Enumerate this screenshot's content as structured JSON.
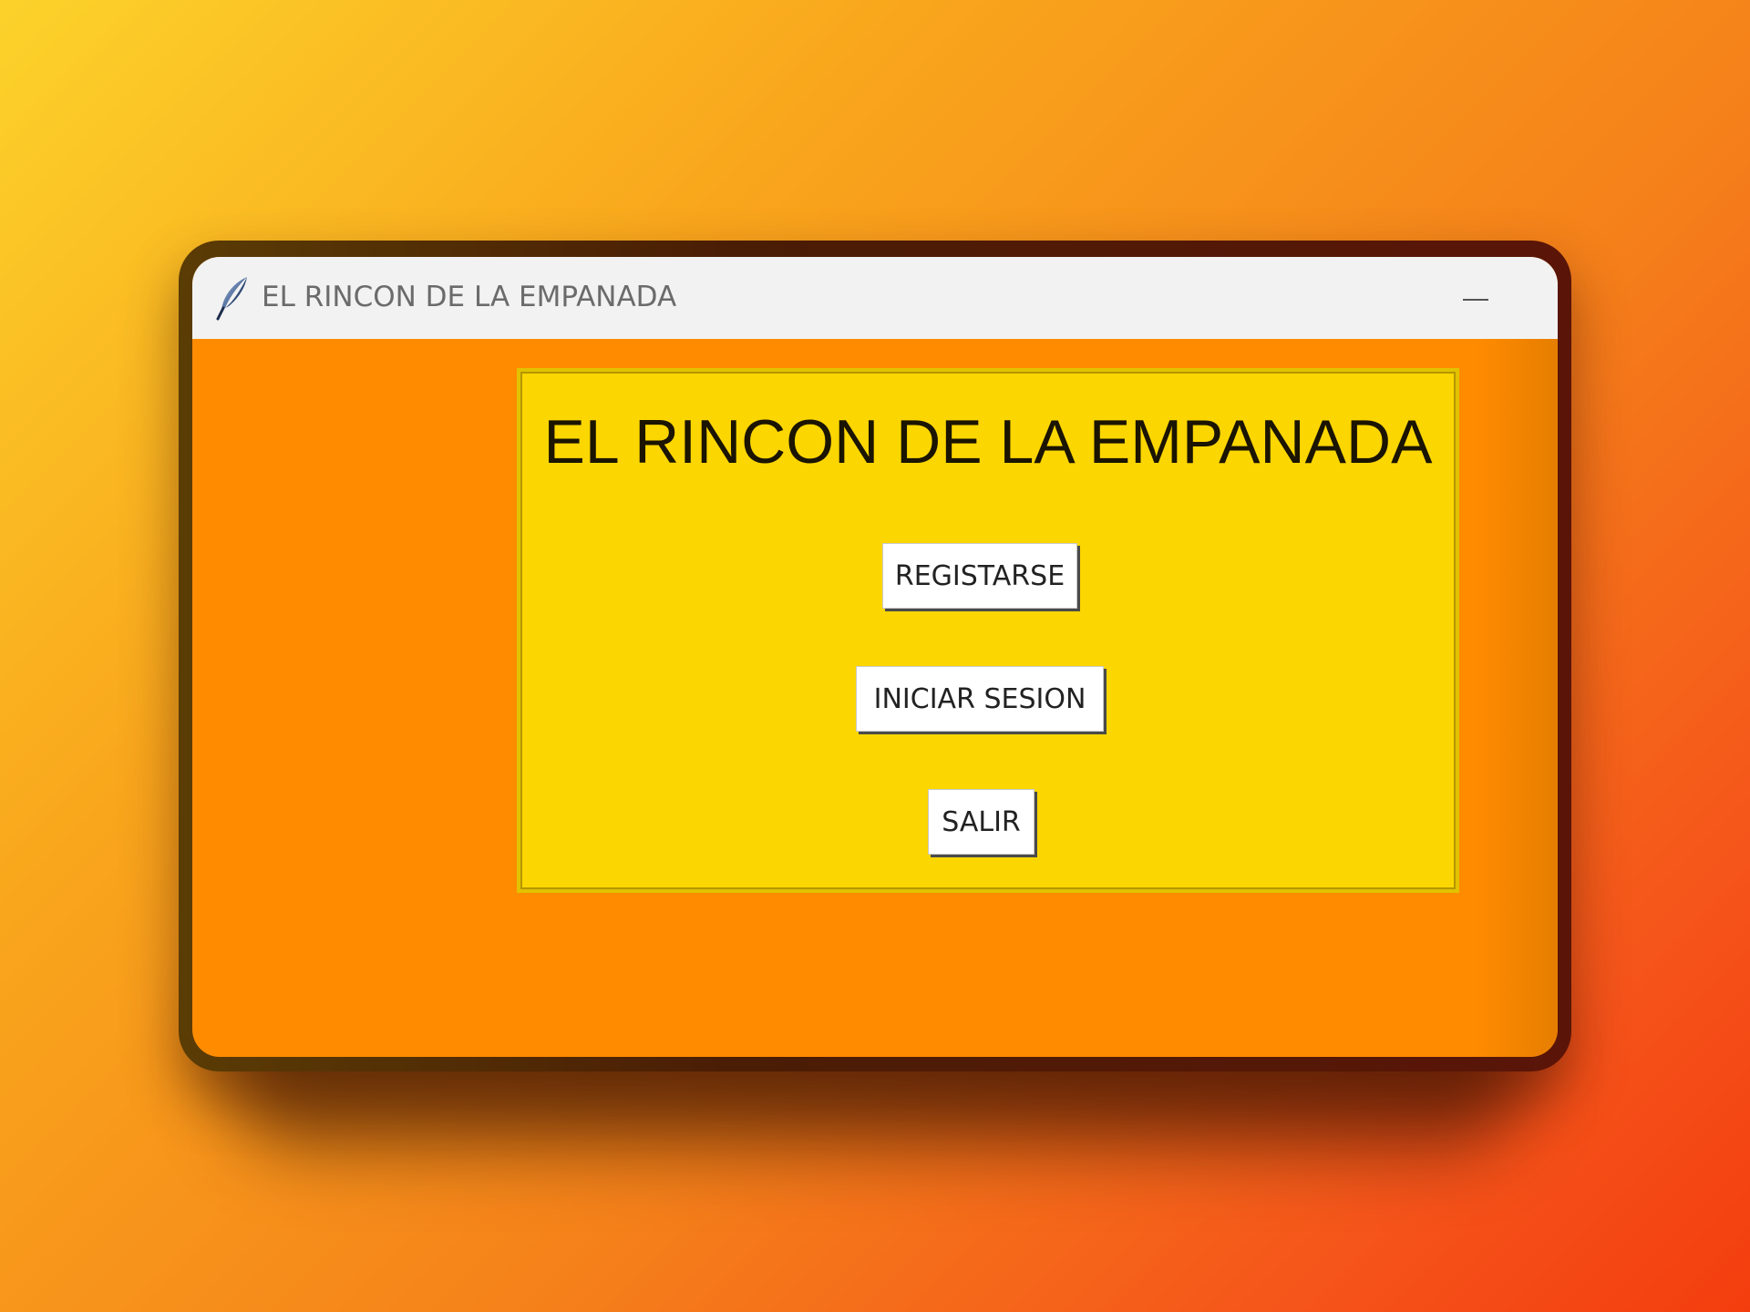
{
  "window": {
    "title": "EL RINCON DE LA EMPANADA",
    "app_icon": "feather-icon",
    "controls": {
      "minimize_icon": "minimize-icon"
    }
  },
  "main": {
    "heading": "EL RINCON DE LA EMPANADA",
    "buttons": {
      "register_label": "REGISTARSE",
      "login_label": "INICIAR SESION",
      "exit_label": "SALIR"
    }
  },
  "colors": {
    "window_background": "#ff8b00",
    "panel_background": "#fcd600",
    "titlebar_background": "#f2f2f2",
    "button_background": "#ffffff"
  }
}
